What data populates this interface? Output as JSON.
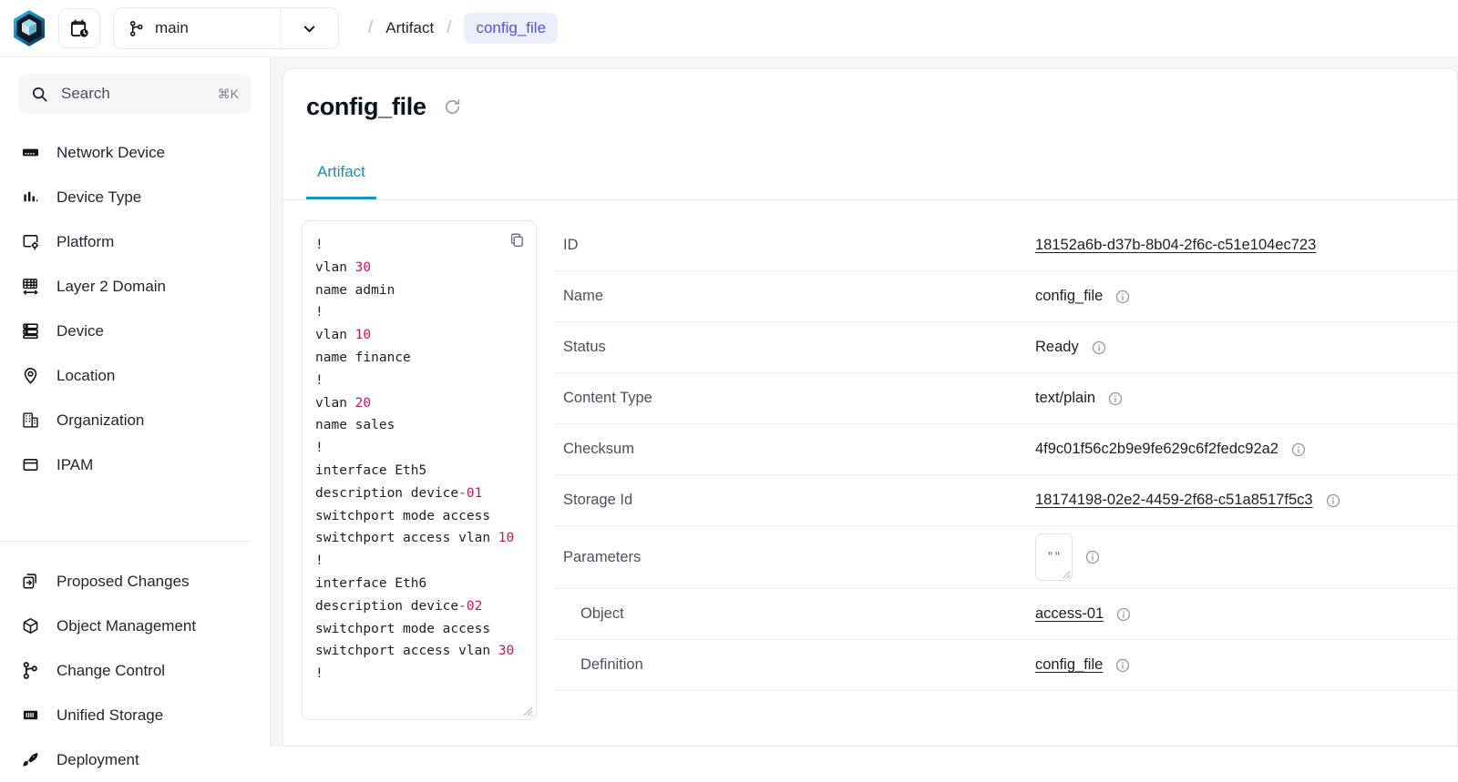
{
  "topbar": {
    "logo_icon": "hexagon-cube-logo",
    "calendar_icon": "calendar-clock-icon",
    "branch": {
      "icon": "git-branch-icon",
      "value": "main",
      "caret_icon": "chevron-down-icon"
    },
    "breadcrumb": {
      "sep": "/",
      "items": [
        {
          "label": "Artifact",
          "active": false
        },
        {
          "label": "config_file",
          "active": true
        }
      ]
    },
    "active_crumb_color": "#4f57d8",
    "active_crumb_bg": "#eceefc"
  },
  "sidebar": {
    "search": {
      "icon": "search-icon",
      "placeholder": "Search",
      "shortcut": "⌘K"
    },
    "items": [
      {
        "label": "Network Device",
        "icon": "server-rack-icon"
      },
      {
        "label": "Device Type",
        "icon": "bar-chart-icon"
      },
      {
        "label": "Platform",
        "icon": "window-gear-icon"
      },
      {
        "label": "Layer 2 Domain",
        "icon": "network-switch-icon"
      },
      {
        "label": "Device",
        "icon": "server-stack-icon"
      },
      {
        "label": "Location",
        "icon": "map-pin-icon"
      },
      {
        "label": "Organization",
        "icon": "building-icon"
      },
      {
        "label": "IPAM",
        "icon": "ipam-icon"
      }
    ],
    "bottom_items": [
      {
        "label": "Proposed Changes",
        "icon": "copy-arrow-icon"
      },
      {
        "label": "Object Management",
        "icon": "cube-icon"
      },
      {
        "label": "Change Control",
        "icon": "git-branch-icon"
      },
      {
        "label": "Unified Storage",
        "icon": "storage-icon"
      },
      {
        "label": "Deployment",
        "icon": "rocket-icon"
      }
    ]
  },
  "main": {
    "title": "config_file",
    "refresh_icon": "refresh-icon",
    "tabs": [
      {
        "label": "Artifact",
        "active": true
      }
    ],
    "tab_accent": "#1597bf",
    "code_panel": {
      "copy_icon": "copy-icon",
      "lines": [
        [
          {
            "t": "!"
          }
        ],
        [
          {
            "t": "vlan "
          },
          {
            "t": "30",
            "c": "num"
          }
        ],
        [
          {
            "t": " name admin"
          }
        ],
        [
          {
            "t": "!"
          }
        ],
        [
          {
            "t": "vlan "
          },
          {
            "t": "10",
            "c": "num"
          }
        ],
        [
          {
            "t": " name finance"
          }
        ],
        [
          {
            "t": "!"
          }
        ],
        [
          {
            "t": "vlan "
          },
          {
            "t": "20",
            "c": "num"
          }
        ],
        [
          {
            "t": " name sales"
          }
        ],
        [
          {
            "t": "!"
          }
        ],
        [
          {
            "t": "interface Eth5"
          }
        ],
        [
          {
            "t": " description device"
          },
          {
            "t": "-01",
            "c": "num"
          }
        ],
        [
          {
            "t": " switchport mode access"
          }
        ],
        [
          {
            "t": " switchport access vlan "
          },
          {
            "t": "10",
            "c": "num"
          }
        ],
        [
          {
            "t": "!"
          }
        ],
        [
          {
            "t": "interface Eth6"
          }
        ],
        [
          {
            "t": " description device"
          },
          {
            "t": "-02",
            "c": "num"
          }
        ],
        [
          {
            "t": " switchport mode access"
          }
        ],
        [
          {
            "t": " switchport access vlan "
          },
          {
            "t": "30",
            "c": "num"
          }
        ],
        [
          {
            "t": "!"
          }
        ]
      ],
      "number_color": "#c2185b"
    },
    "details": [
      {
        "label": "ID",
        "value": "18152a6b-d37b-8b04-2f6c-c51e104ec723",
        "link": true,
        "info": false,
        "sub": false
      },
      {
        "label": "Name",
        "value": "config_file",
        "link": false,
        "info": true,
        "sub": false
      },
      {
        "label": "Status",
        "value": "Ready",
        "link": false,
        "info": true,
        "sub": false
      },
      {
        "label": "Content Type",
        "value": "text/plain",
        "link": false,
        "info": true,
        "sub": false
      },
      {
        "label": "Checksum",
        "value": "4f9c01f56c2b9e9fe629c6f2fedc92a2",
        "link": false,
        "info": true,
        "sub": false
      },
      {
        "label": "Storage Id",
        "value": "18174198-02e2-4459-2f68-c51a8517f5c3",
        "link": true,
        "info": true,
        "sub": false
      },
      {
        "label": "Parameters",
        "value": "\"\"",
        "link": false,
        "info": true,
        "sub": false,
        "widget": "textarea"
      },
      {
        "label": "Object",
        "value": "access-01",
        "link": true,
        "info": true,
        "sub": true
      },
      {
        "label": "Definition",
        "value": "config_file",
        "link": true,
        "info": true,
        "sub": true
      }
    ],
    "info_icon": "info-icon"
  }
}
